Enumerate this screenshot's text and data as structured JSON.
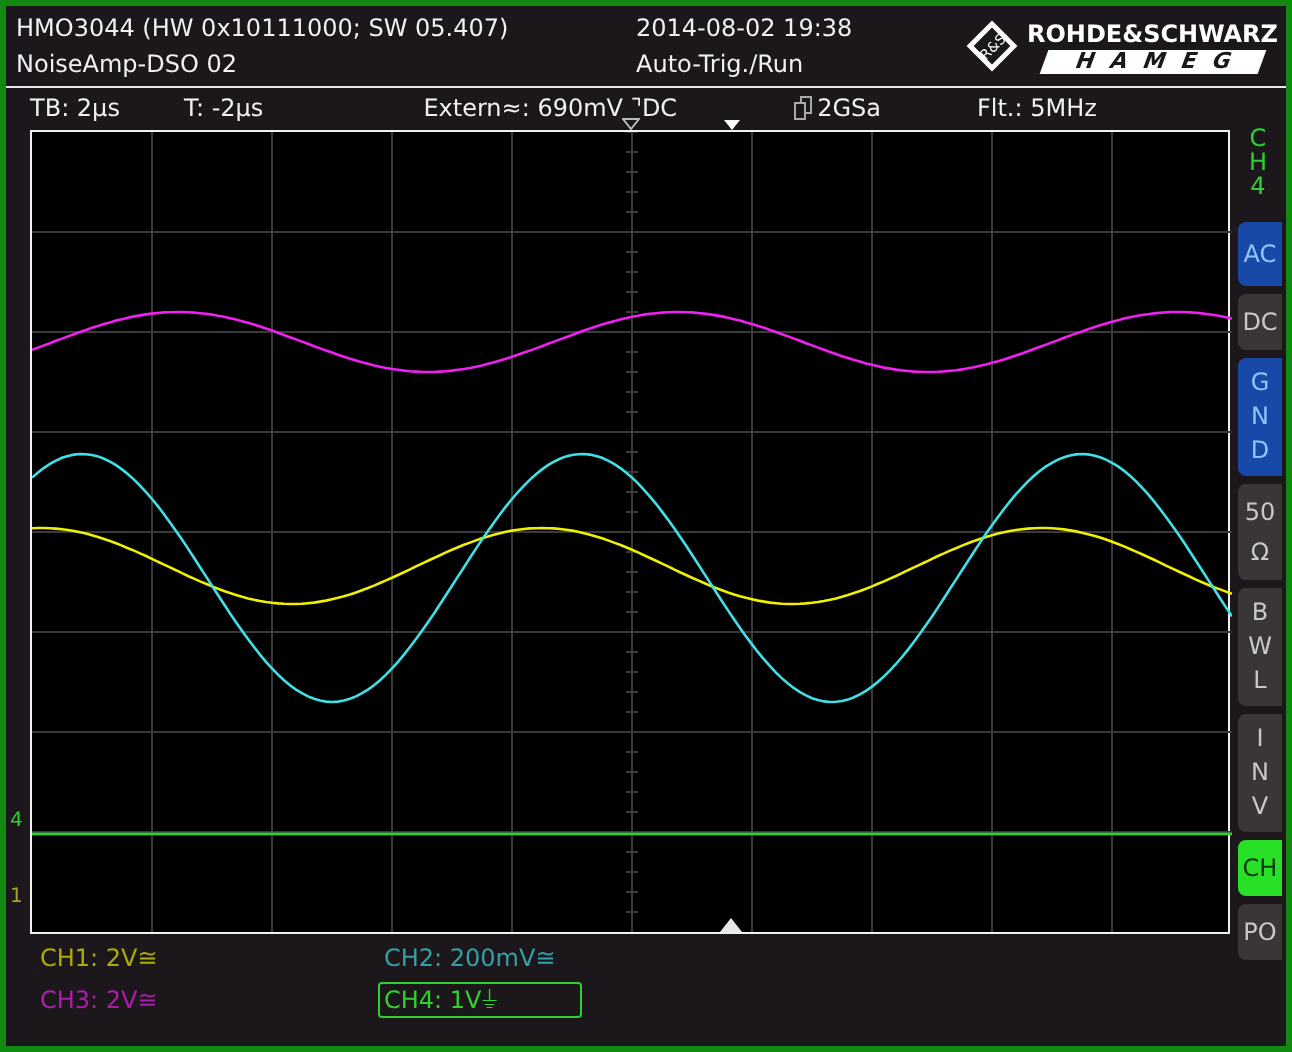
{
  "header": {
    "model": "HMO3044 (HW 0x10111000; SW 05.407)",
    "setup": "NoiseAmp-DSO 02",
    "datetime": "2014-08-02 19:38",
    "mode": "Auto-Trig./Run",
    "logo": {
      "mark": "R&S",
      "brand": "ROHDE&SCHWARZ",
      "sub": "HAMEG"
    }
  },
  "info": {
    "timebase": "TB: 2µs",
    "trigger_time": "T: -2µs",
    "trigger": "Extern≈: 690mV ⌝DC",
    "sample_rate": "2GSa",
    "filter": "Flt.: 5MHz"
  },
  "markers": {
    "ch4": "4",
    "ch1": "1"
  },
  "channels": [
    {
      "label": "CH1: 2V≅",
      "color": "#f0f000",
      "selected": false
    },
    {
      "label": "CH2: 200mV≅",
      "color": "#40e0e8",
      "selected": false
    },
    {
      "label": "CH3: 2V≅",
      "color": "#f020f0",
      "selected": false
    },
    {
      "label": "CH4: 1V⏚",
      "color": "#30d030",
      "selected": true
    }
  ],
  "side_menu": {
    "title": "CH4",
    "buttons": [
      {
        "label": "AC",
        "kind": "option",
        "selected": true
      },
      {
        "label": "DC",
        "kind": "option",
        "selected": false
      },
      {
        "label": "GND",
        "kind": "option",
        "selected": true
      },
      {
        "label": "50 Ω",
        "kind": "option",
        "selected": false
      },
      {
        "label": "BWL",
        "kind": "option",
        "selected": false
      },
      {
        "label": "INV",
        "kind": "option",
        "selected": false
      },
      {
        "label": "CH",
        "kind": "channel",
        "selected": true
      },
      {
        "label": "PO",
        "kind": "option",
        "selected": false
      }
    ]
  }
}
